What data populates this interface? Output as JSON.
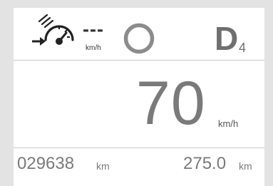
{
  "top_bar": {
    "cruise_icon": "cruise-control-gauge-icon",
    "set_speed": "---",
    "set_speed_unit": "km/h",
    "status_ring_icon": "status-ring-icon",
    "gear_letter": "D",
    "gear_number": "4"
  },
  "main": {
    "speed": "70",
    "speed_unit": "km/h"
  },
  "bottom_bar": {
    "odometer": "029638",
    "odometer_unit": "km",
    "trip": "275.0",
    "trip_unit": "km"
  },
  "colors": {
    "background": "#e3e3e3",
    "panel": "#ffffff",
    "divider": "#c7c7c7",
    "text_gray": "#7a7a7a",
    "icon_dark": "#222222"
  }
}
